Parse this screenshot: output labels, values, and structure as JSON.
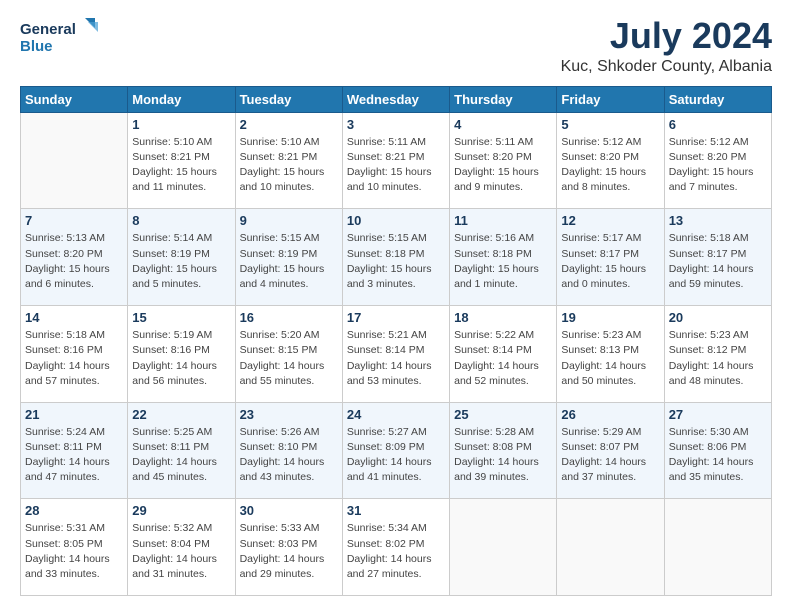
{
  "header": {
    "logo_line1": "General",
    "logo_line2": "Blue",
    "month": "July 2024",
    "location": "Kuc, Shkoder County, Albania"
  },
  "weekdays": [
    "Sunday",
    "Monday",
    "Tuesday",
    "Wednesday",
    "Thursday",
    "Friday",
    "Saturday"
  ],
  "weeks": [
    [
      {
        "day": "",
        "sunrise": "",
        "sunset": "",
        "daylight": ""
      },
      {
        "day": "1",
        "sunrise": "Sunrise: 5:10 AM",
        "sunset": "Sunset: 8:21 PM",
        "daylight": "Daylight: 15 hours and 11 minutes."
      },
      {
        "day": "2",
        "sunrise": "Sunrise: 5:10 AM",
        "sunset": "Sunset: 8:21 PM",
        "daylight": "Daylight: 15 hours and 10 minutes."
      },
      {
        "day": "3",
        "sunrise": "Sunrise: 5:11 AM",
        "sunset": "Sunset: 8:21 PM",
        "daylight": "Daylight: 15 hours and 10 minutes."
      },
      {
        "day": "4",
        "sunrise": "Sunrise: 5:11 AM",
        "sunset": "Sunset: 8:20 PM",
        "daylight": "Daylight: 15 hours and 9 minutes."
      },
      {
        "day": "5",
        "sunrise": "Sunrise: 5:12 AM",
        "sunset": "Sunset: 8:20 PM",
        "daylight": "Daylight: 15 hours and 8 minutes."
      },
      {
        "day": "6",
        "sunrise": "Sunrise: 5:12 AM",
        "sunset": "Sunset: 8:20 PM",
        "daylight": "Daylight: 15 hours and 7 minutes."
      }
    ],
    [
      {
        "day": "7",
        "sunrise": "Sunrise: 5:13 AM",
        "sunset": "Sunset: 8:20 PM",
        "daylight": "Daylight: 15 hours and 6 minutes."
      },
      {
        "day": "8",
        "sunrise": "Sunrise: 5:14 AM",
        "sunset": "Sunset: 8:19 PM",
        "daylight": "Daylight: 15 hours and 5 minutes."
      },
      {
        "day": "9",
        "sunrise": "Sunrise: 5:15 AM",
        "sunset": "Sunset: 8:19 PM",
        "daylight": "Daylight: 15 hours and 4 minutes."
      },
      {
        "day": "10",
        "sunrise": "Sunrise: 5:15 AM",
        "sunset": "Sunset: 8:18 PM",
        "daylight": "Daylight: 15 hours and 3 minutes."
      },
      {
        "day": "11",
        "sunrise": "Sunrise: 5:16 AM",
        "sunset": "Sunset: 8:18 PM",
        "daylight": "Daylight: 15 hours and 1 minute."
      },
      {
        "day": "12",
        "sunrise": "Sunrise: 5:17 AM",
        "sunset": "Sunset: 8:17 PM",
        "daylight": "Daylight: 15 hours and 0 minutes."
      },
      {
        "day": "13",
        "sunrise": "Sunrise: 5:18 AM",
        "sunset": "Sunset: 8:17 PM",
        "daylight": "Daylight: 14 hours and 59 minutes."
      }
    ],
    [
      {
        "day": "14",
        "sunrise": "Sunrise: 5:18 AM",
        "sunset": "Sunset: 8:16 PM",
        "daylight": "Daylight: 14 hours and 57 minutes."
      },
      {
        "day": "15",
        "sunrise": "Sunrise: 5:19 AM",
        "sunset": "Sunset: 8:16 PM",
        "daylight": "Daylight: 14 hours and 56 minutes."
      },
      {
        "day": "16",
        "sunrise": "Sunrise: 5:20 AM",
        "sunset": "Sunset: 8:15 PM",
        "daylight": "Daylight: 14 hours and 55 minutes."
      },
      {
        "day": "17",
        "sunrise": "Sunrise: 5:21 AM",
        "sunset": "Sunset: 8:14 PM",
        "daylight": "Daylight: 14 hours and 53 minutes."
      },
      {
        "day": "18",
        "sunrise": "Sunrise: 5:22 AM",
        "sunset": "Sunset: 8:14 PM",
        "daylight": "Daylight: 14 hours and 52 minutes."
      },
      {
        "day": "19",
        "sunrise": "Sunrise: 5:23 AM",
        "sunset": "Sunset: 8:13 PM",
        "daylight": "Daylight: 14 hours and 50 minutes."
      },
      {
        "day": "20",
        "sunrise": "Sunrise: 5:23 AM",
        "sunset": "Sunset: 8:12 PM",
        "daylight": "Daylight: 14 hours and 48 minutes."
      }
    ],
    [
      {
        "day": "21",
        "sunrise": "Sunrise: 5:24 AM",
        "sunset": "Sunset: 8:11 PM",
        "daylight": "Daylight: 14 hours and 47 minutes."
      },
      {
        "day": "22",
        "sunrise": "Sunrise: 5:25 AM",
        "sunset": "Sunset: 8:11 PM",
        "daylight": "Daylight: 14 hours and 45 minutes."
      },
      {
        "day": "23",
        "sunrise": "Sunrise: 5:26 AM",
        "sunset": "Sunset: 8:10 PM",
        "daylight": "Daylight: 14 hours and 43 minutes."
      },
      {
        "day": "24",
        "sunrise": "Sunrise: 5:27 AM",
        "sunset": "Sunset: 8:09 PM",
        "daylight": "Daylight: 14 hours and 41 minutes."
      },
      {
        "day": "25",
        "sunrise": "Sunrise: 5:28 AM",
        "sunset": "Sunset: 8:08 PM",
        "daylight": "Daylight: 14 hours and 39 minutes."
      },
      {
        "day": "26",
        "sunrise": "Sunrise: 5:29 AM",
        "sunset": "Sunset: 8:07 PM",
        "daylight": "Daylight: 14 hours and 37 minutes."
      },
      {
        "day": "27",
        "sunrise": "Sunrise: 5:30 AM",
        "sunset": "Sunset: 8:06 PM",
        "daylight": "Daylight: 14 hours and 35 minutes."
      }
    ],
    [
      {
        "day": "28",
        "sunrise": "Sunrise: 5:31 AM",
        "sunset": "Sunset: 8:05 PM",
        "daylight": "Daylight: 14 hours and 33 minutes."
      },
      {
        "day": "29",
        "sunrise": "Sunrise: 5:32 AM",
        "sunset": "Sunset: 8:04 PM",
        "daylight": "Daylight: 14 hours and 31 minutes."
      },
      {
        "day": "30",
        "sunrise": "Sunrise: 5:33 AM",
        "sunset": "Sunset: 8:03 PM",
        "daylight": "Daylight: 14 hours and 29 minutes."
      },
      {
        "day": "31",
        "sunrise": "Sunrise: 5:34 AM",
        "sunset": "Sunset: 8:02 PM",
        "daylight": "Daylight: 14 hours and 27 minutes."
      },
      {
        "day": "",
        "sunrise": "",
        "sunset": "",
        "daylight": ""
      },
      {
        "day": "",
        "sunrise": "",
        "sunset": "",
        "daylight": ""
      },
      {
        "day": "",
        "sunrise": "",
        "sunset": "",
        "daylight": ""
      }
    ]
  ]
}
